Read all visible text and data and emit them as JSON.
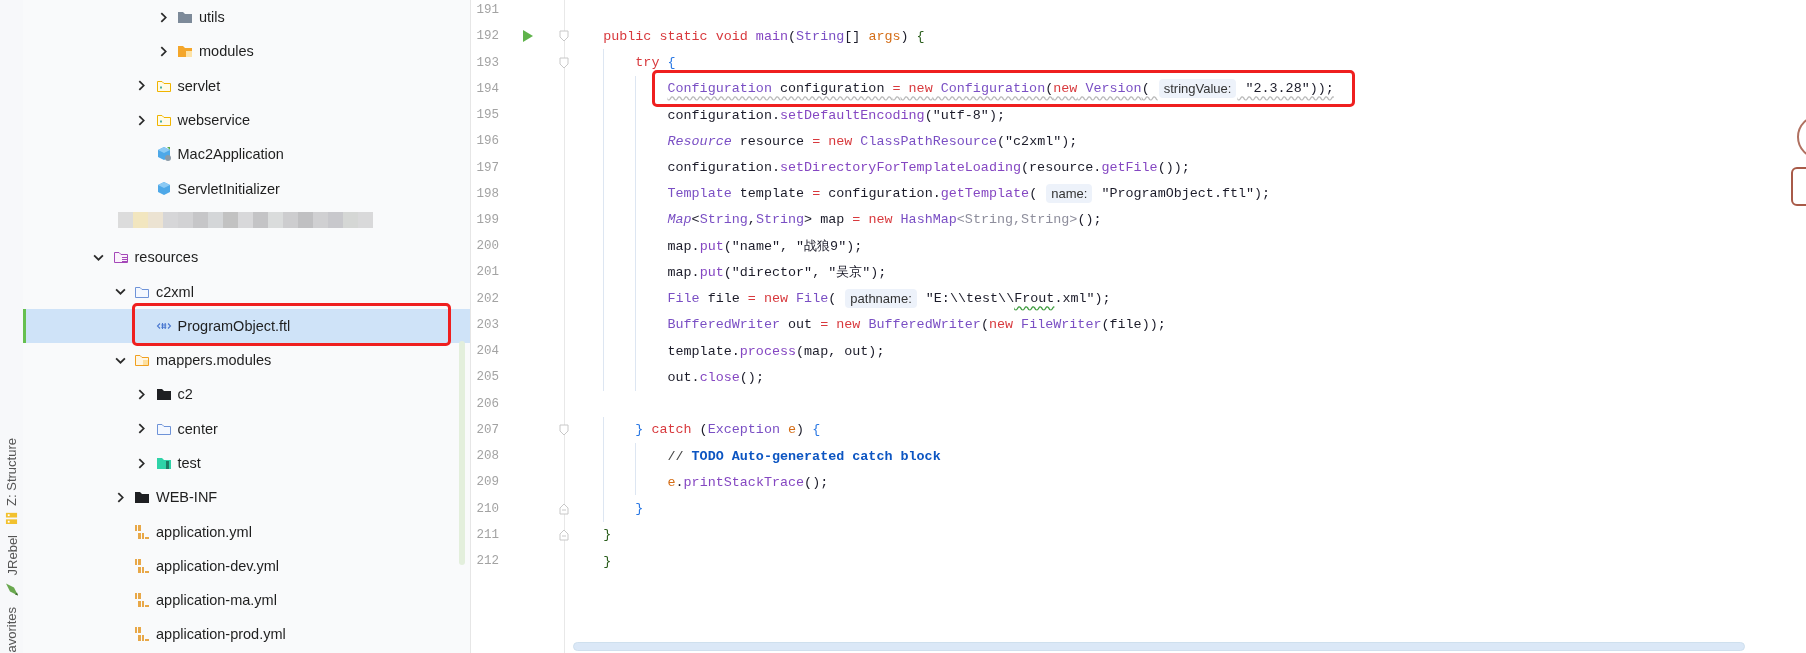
{
  "tool_strip": {
    "items": [
      {
        "label": "Z: Structure",
        "kind": "structure"
      },
      {
        "label": "JRebel",
        "kind": "jrebel"
      },
      {
        "label": "avorites"
      }
    ]
  },
  "project_tree": {
    "items": [
      {
        "children": [
          {
            "children": [
              {
                "children": [
                  {
                    "label": "utils",
                    "kind": "grey-folder",
                    "expanded": false,
                    "selected": false
                  },
                  {
                    "label": "modules",
                    "kind": "module-folder",
                    "expanded": false,
                    "selected": false
                  }
                ]
              },
              {
                "label": "servlet",
                "kind": "package",
                "expanded": false,
                "selected": false
              },
              {
                "label": "webservice",
                "kind": "package",
                "expanded": false,
                "selected": false
              },
              {
                "label": "Mac2Application",
                "kind": "spring-class",
                "selected": false
              },
              {
                "label": "ServletInitializer",
                "kind": "class",
                "selected": false
              }
            ]
          }
        ]
      },
      {
        "kind": "redacted"
      },
      {
        "label": "resources",
        "kind": "resources-folder",
        "expanded": true,
        "selected": false,
        "children": [
          {
            "label": "c2xml",
            "kind": "folder",
            "expanded": true,
            "selected": false,
            "children": [
              {
                "label": "ProgramObject.ftl",
                "kind": "ftl",
                "selected": true,
                "boxed": true
              }
            ]
          },
          {
            "label": "mappers.modules",
            "kind": "mapper-folder",
            "expanded": true,
            "selected": false,
            "children": [
              {
                "label": "c2",
                "kind": "dark-folder",
                "expanded": false,
                "selected": false
              },
              {
                "label": "center",
                "kind": "folder",
                "expanded": false,
                "selected": false
              },
              {
                "label": "test",
                "kind": "test-folder",
                "expanded": false,
                "selected": false
              }
            ]
          },
          {
            "label": "WEB-INF",
            "kind": "dark-folder",
            "expanded": false,
            "selected": false
          },
          {
            "label": "application.yml",
            "kind": "yaml",
            "selected": false
          },
          {
            "label": "application-dev.yml",
            "kind": "yaml",
            "selected": false
          },
          {
            "label": "application-ma.yml",
            "kind": "yaml",
            "selected": false
          },
          {
            "label": "application-prod.yml",
            "kind": "yaml",
            "selected": false
          }
        ]
      }
    ]
  },
  "editor": {
    "lines": [
      {
        "number": "191"
      },
      {
        "number": "192",
        "run": true,
        "fold_start": true,
        "tokens": [
          {
            "text": "    public static void",
            "kind": "kw"
          },
          {
            "text": " main",
            "kind": "method"
          },
          {
            "text": "(",
            "kind": "plain"
          },
          {
            "text": "String",
            "kind": "type"
          },
          {
            "text": "[] ",
            "kind": "plain"
          },
          {
            "text": "args",
            "kind": "param"
          },
          {
            "text": ") ",
            "kind": "plain"
          },
          {
            "text": "{",
            "kind": "brace1"
          }
        ]
      },
      {
        "number": "193",
        "fold_start": true,
        "tokens": [
          {
            "text": "        try",
            "kind": "kw"
          },
          {
            "text": " {",
            "kind": "brace2"
          }
        ]
      },
      {
        "number": "194",
        "boxed": true,
        "warning": true,
        "tokens": [
          {
            "text": "            Configuration",
            "kind": "type"
          },
          {
            "text": " configuration ",
            "kind": "plain"
          },
          {
            "text": "=",
            "kind": "kw"
          },
          {
            "text": " new",
            "kind": "kw"
          },
          {
            "text": " Configuration",
            "kind": "type"
          },
          {
            "text": "(",
            "kind": "plain"
          },
          {
            "text": "new",
            "kind": "kw"
          },
          {
            "text": " Version",
            "kind": "type"
          },
          {
            "text": "( ",
            "kind": "plain"
          },
          {
            "text": "stringValue:",
            "kind": "hint"
          },
          {
            "text": " \"2.3.28\"));",
            "kind": "plain"
          }
        ]
      },
      {
        "number": "195",
        "tokens": [
          {
            "text": "            configuration.",
            "kind": "plain"
          },
          {
            "text": "setDefaultEncoding",
            "kind": "method"
          },
          {
            "text": "(\"utf-8\");",
            "kind": "plain"
          }
        ]
      },
      {
        "number": "196",
        "tokens": [
          {
            "text": "            Resource",
            "kind": "itype"
          },
          {
            "text": " resource ",
            "kind": "plain"
          },
          {
            "text": "=",
            "kind": "kw"
          },
          {
            "text": " new",
            "kind": "kw"
          },
          {
            "text": " ClassPathResource",
            "kind": "type"
          },
          {
            "text": "(\"c2xml\");",
            "kind": "plain"
          }
        ]
      },
      {
        "number": "197",
        "tokens": [
          {
            "text": "            configuration.",
            "kind": "plain"
          },
          {
            "text": "setDirectoryForTemplateLoading",
            "kind": "method"
          },
          {
            "text": "(resource.",
            "kind": "plain"
          },
          {
            "text": "getFile",
            "kind": "method"
          },
          {
            "text": "());",
            "kind": "plain"
          }
        ]
      },
      {
        "number": "198",
        "tokens": [
          {
            "text": "            Template",
            "kind": "type"
          },
          {
            "text": " template ",
            "kind": "plain"
          },
          {
            "text": "=",
            "kind": "kw"
          },
          {
            "text": " configuration.",
            "kind": "plain"
          },
          {
            "text": "getTemplate",
            "kind": "method"
          },
          {
            "text": "( ",
            "kind": "plain"
          },
          {
            "text": "name:",
            "kind": "hint"
          },
          {
            "text": " \"ProgramObject.ftl\");",
            "kind": "plain"
          }
        ]
      },
      {
        "number": "199",
        "tokens": [
          {
            "text": "            Map",
            "kind": "itype"
          },
          {
            "text": "<",
            "kind": "plain"
          },
          {
            "text": "String",
            "kind": "type"
          },
          {
            "text": ",",
            "kind": "plain"
          },
          {
            "text": "String",
            "kind": "type"
          },
          {
            "text": "> map ",
            "kind": "plain"
          },
          {
            "text": "=",
            "kind": "kw"
          },
          {
            "text": " new",
            "kind": "kw"
          },
          {
            "text": " HashMap",
            "kind": "type"
          },
          {
            "text": "<String,String>",
            "kind": "generic"
          },
          {
            "text": "();",
            "kind": "plain"
          }
        ]
      },
      {
        "number": "200",
        "tokens": [
          {
            "text": "            map.",
            "kind": "plain"
          },
          {
            "text": "put",
            "kind": "method"
          },
          {
            "text": "(\"name\", \"战狼9\");",
            "kind": "plain"
          }
        ]
      },
      {
        "number": "201",
        "tokens": [
          {
            "text": "            map.",
            "kind": "plain"
          },
          {
            "text": "put",
            "kind": "method"
          },
          {
            "text": "(\"director\", \"吴京\");",
            "kind": "plain"
          }
        ]
      },
      {
        "number": "202",
        "tokens": [
          {
            "text": "            File",
            "kind": "type"
          },
          {
            "text": " file ",
            "kind": "plain"
          },
          {
            "text": "=",
            "kind": "kw"
          },
          {
            "text": " new",
            "kind": "kw"
          },
          {
            "text": " File",
            "kind": "type"
          },
          {
            "text": "( ",
            "kind": "plain"
          },
          {
            "text": "pathname:",
            "kind": "hint"
          },
          {
            "text": " \"E:\\\\test\\\\",
            "kind": "plain"
          },
          {
            "text": "Frout",
            "kind": "plain",
            "typo": true
          },
          {
            "text": ".xml\");",
            "kind": "plain"
          }
        ]
      },
      {
        "number": "203",
        "tokens": [
          {
            "text": "            BufferedWriter",
            "kind": "type"
          },
          {
            "text": " out ",
            "kind": "plain"
          },
          {
            "text": "=",
            "kind": "kw"
          },
          {
            "text": " new",
            "kind": "kw"
          },
          {
            "text": " BufferedWriter",
            "kind": "type"
          },
          {
            "text": "(",
            "kind": "plain"
          },
          {
            "text": "new",
            "kind": "kw"
          },
          {
            "text": " FileWriter",
            "kind": "type"
          },
          {
            "text": "(file));",
            "kind": "plain"
          }
        ]
      },
      {
        "number": "204",
        "tokens": [
          {
            "text": "            template.",
            "kind": "plain"
          },
          {
            "text": "process",
            "kind": "method"
          },
          {
            "text": "(map, out);",
            "kind": "plain"
          }
        ]
      },
      {
        "number": "205",
        "tokens": [
          {
            "text": "            out.",
            "kind": "plain"
          },
          {
            "text": "close",
            "kind": "method"
          },
          {
            "text": "();",
            "kind": "plain"
          }
        ]
      },
      {
        "number": "206"
      },
      {
        "number": "207",
        "fold_start": true,
        "tokens": [
          {
            "text": "        }",
            "kind": "brace2"
          },
          {
            "text": " catch",
            "kind": "kw"
          },
          {
            "text": " (",
            "kind": "plain"
          },
          {
            "text": "Exception",
            "kind": "type"
          },
          {
            "text": " e",
            "kind": "param"
          },
          {
            "text": ") ",
            "kind": "plain"
          },
          {
            "text": "{",
            "kind": "brace2"
          }
        ]
      },
      {
        "number": "208",
        "tokens": [
          {
            "text": "            // ",
            "kind": "comment"
          },
          {
            "text": "TODO Auto-generated catch block",
            "kind": "todo"
          }
        ]
      },
      {
        "number": "209",
        "tokens": [
          {
            "text": "            e",
            "kind": "param"
          },
          {
            "text": ".",
            "kind": "plain"
          },
          {
            "text": "printStackTrace",
            "kind": "method"
          },
          {
            "text": "();",
            "kind": "plain"
          }
        ]
      },
      {
        "number": "210",
        "fold_end": true,
        "tokens": [
          {
            "text": "        }",
            "kind": "brace2"
          }
        ]
      },
      {
        "number": "211",
        "fold_end": true,
        "tokens": [
          {
            "text": "    }",
            "kind": "brace1"
          }
        ]
      },
      {
        "number": "212",
        "tokens": [
          {
            "text": "    }",
            "kind": "brace1"
          }
        ]
      }
    ]
  }
}
